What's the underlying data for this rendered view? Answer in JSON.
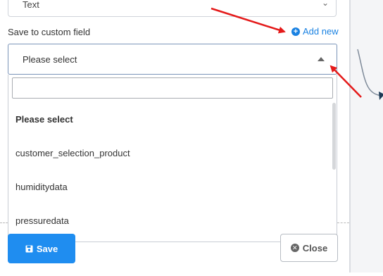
{
  "top_select": {
    "value": "Text"
  },
  "custom_field": {
    "label": "Save to custom field",
    "add_new": "Add new",
    "selected": "Please select"
  },
  "dropdown": {
    "search_value": "",
    "options": [
      {
        "label": "Please select"
      },
      {
        "label": "customer_selection_product"
      },
      {
        "label": "humiditydata"
      },
      {
        "label": "pressuredata"
      }
    ]
  },
  "buttons": {
    "save": "Save",
    "close": "Close"
  },
  "colors": {
    "primary": "#1f8df0",
    "link": "#1a82e2",
    "annotation": "#e41a1a"
  }
}
